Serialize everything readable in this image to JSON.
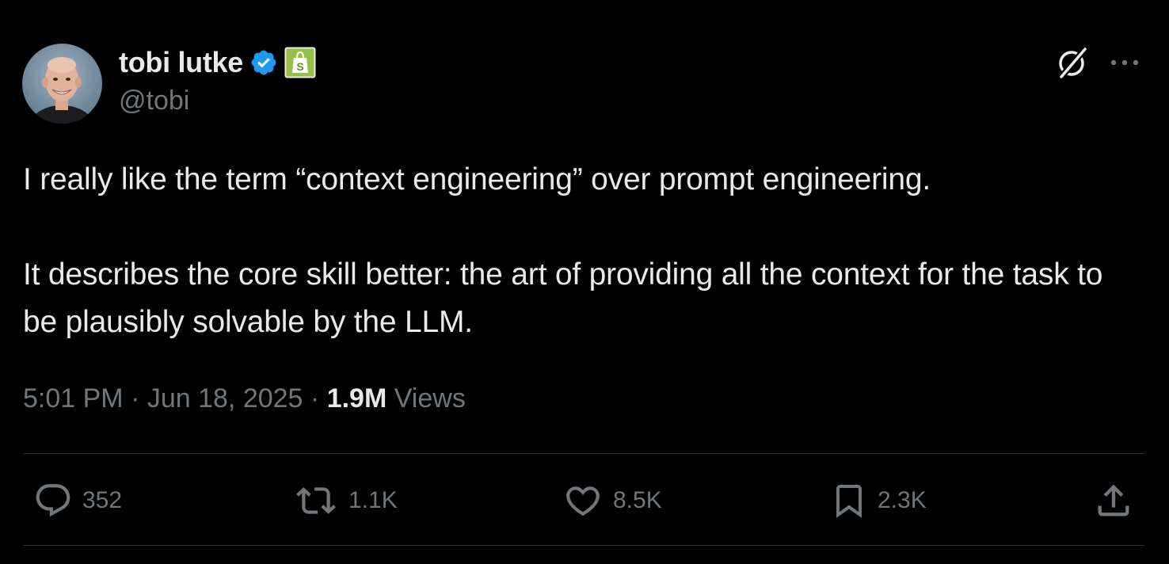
{
  "author": {
    "display_name": "tobi lutke",
    "handle": "@tobi",
    "verified_icon": "verified-badge-icon",
    "affiliate_icon": "shopify-bag-icon"
  },
  "header_actions": {
    "grok_icon": "grok-slash-icon",
    "more_icon": "more-dots-icon"
  },
  "tweet": {
    "paragraph_1": "I really like the term “context engineering” over prompt engineering.",
    "paragraph_2": "It describes the core skill better: the art of providing all the context for the task to be plausibly solvable by the LLM."
  },
  "meta": {
    "time": "5:01 PM",
    "separator": " · ",
    "date": "Jun 18, 2025",
    "views_count": "1.9M",
    "views_label": "Views"
  },
  "actions": {
    "replies": "352",
    "reposts": "1.1K",
    "likes": "8.5K",
    "bookmarks": "2.3K",
    "share_icon": "share-upload-icon"
  },
  "colors": {
    "background": "#000000",
    "primary_text": "#e7e9ea",
    "secondary_text": "#71767b",
    "divider": "#2f3336",
    "verified_blue": "#1d9bf0",
    "shopify_green": "#95bf47"
  }
}
